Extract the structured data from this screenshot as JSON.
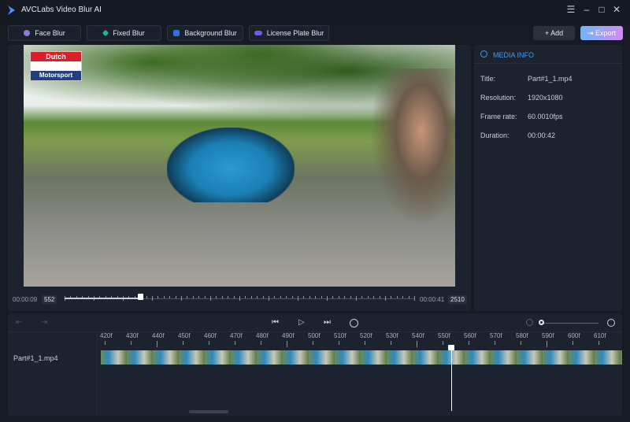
{
  "app": {
    "title": "AVCLabs Video Blur AI"
  },
  "toolbar": {
    "face_blur": "Face Blur",
    "fixed_blur": "Fixed Blur",
    "background_blur": "Background Blur",
    "license_plate_blur": "License Plate Blur",
    "add": "+ Add",
    "export": "Export"
  },
  "video": {
    "watermark_top": "Dutch",
    "watermark_bottom": "Motorsport",
    "current_time": "00:00:09",
    "current_frame": "552",
    "end_time": "00:00:41",
    "end_frame": "2510",
    "progress": 0.22
  },
  "media_info": {
    "header": "MEDIA INFO",
    "rows": [
      {
        "label": "Title:",
        "value": "Part#1_1.mp4"
      },
      {
        "label": "Resolution:",
        "value": "1920x1080"
      },
      {
        "label": "Frame rate:",
        "value": "60.0010fps"
      },
      {
        "label": "Duration:",
        "value": "00:00:42"
      }
    ]
  },
  "timeline": {
    "track_name": "Part#1_1.mp4",
    "ruler": [
      "420f",
      "430f",
      "440f",
      "450f",
      "460f",
      "470f",
      "480f",
      "490f",
      "500f",
      "510f",
      "520f",
      "530f",
      "540f",
      "550f",
      "560f",
      "570f",
      "580f",
      "590f",
      "600f",
      "610f"
    ],
    "zoom": 0
  }
}
